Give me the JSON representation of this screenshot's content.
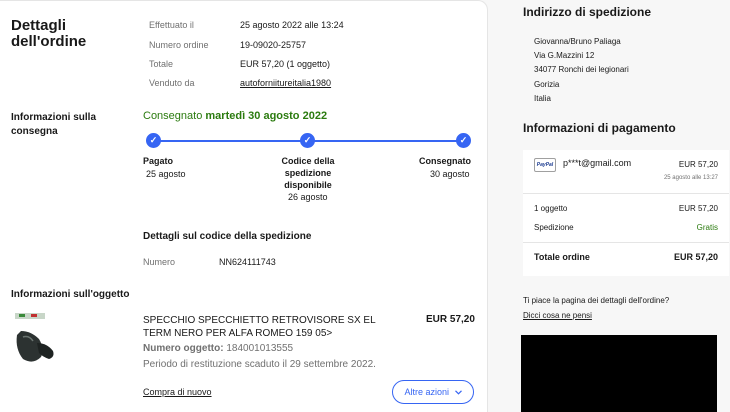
{
  "order": {
    "title": "Dettagli dell'ordine",
    "rows": [
      {
        "label": "Effettuato il",
        "value": "25 agosto 2022 alle 13:24"
      },
      {
        "label": "Numero ordine",
        "value": "19-09020-25757"
      },
      {
        "label": "Totale",
        "value": "EUR 57,20 (1 oggetto)"
      },
      {
        "label": "Venduto da",
        "value": "autoforniitureitalia1980"
      }
    ]
  },
  "delivery": {
    "title": "Informazioni sulla consegna",
    "status_prefix": "Consegnato",
    "status_date": "martedì 30 agosto 2022",
    "steps": [
      {
        "label": "Pagato",
        "date": "25 agosto"
      },
      {
        "label": "Codice della spedizione disponibile",
        "date": "26 agosto"
      },
      {
        "label": "Consegnato",
        "date": "30 agosto"
      }
    ],
    "check_glyph": "✓"
  },
  "tracking": {
    "title": "Dettagli sul codice della spedizione",
    "label": "Numero",
    "value": "NN624111743"
  },
  "item": {
    "section_title": "Informazioni sull'oggetto",
    "name": "SPECCHIO SPECCHIETTO RETROVISORE SX EL TERM NERO PER ALFA ROMEO 159 05>",
    "price": "EUR 57,20",
    "number_label": "Numero oggetto:",
    "number_value": "184001013555",
    "return_text": "Periodo di restituzione scaduto il 29 settembre 2022.",
    "buy_again": "Compra di nuovo",
    "actions_label": "Altre azioni",
    "actions_icon": "chevron-down"
  },
  "shipping": {
    "title": "Indirizzo di spedizione",
    "lines": [
      "Giovanna/Bruno Paliaga",
      "Via G.Mazzini 12",
      "34077 Ronchi dei legionari",
      "Gorizia",
      "Italia"
    ]
  },
  "payment": {
    "title": "Informazioni di pagamento",
    "method_logo": "PayPal",
    "email": "p***t@gmail.com",
    "amount": "EUR 57,20",
    "date": "25 agosto alle 13:27",
    "summary": [
      {
        "label": "1 oggetto",
        "value": "EUR 57,20"
      },
      {
        "label": "Spedizione",
        "value": "Gratis"
      }
    ],
    "total_label": "Totale ordine",
    "total_value": "EUR 57,20"
  },
  "feedback": {
    "question": "Ti piace la pagina dei dettagli dell'ordine?",
    "link": "Dicci cosa ne pensi"
  },
  "colors": {
    "accent": "#3665f3",
    "success": "#2b7b0f",
    "muted": "#707070"
  }
}
